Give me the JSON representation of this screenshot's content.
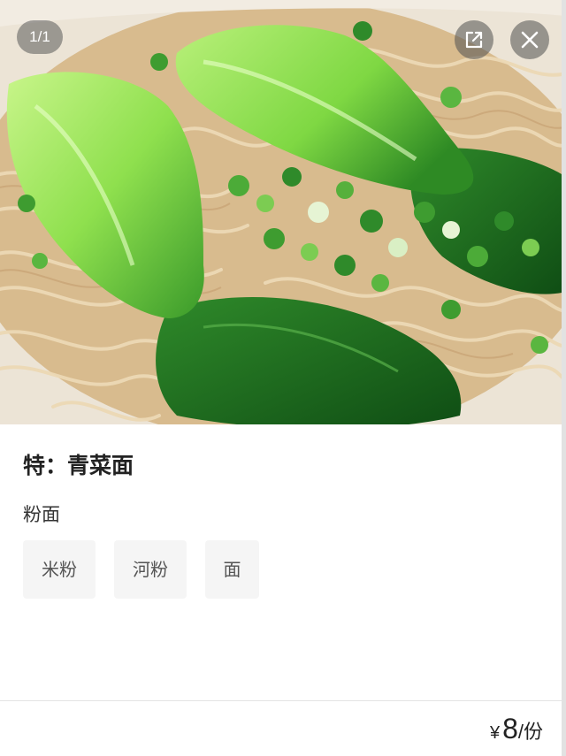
{
  "image": {
    "page_indicator": "1/1",
    "alt_icons": {
      "share": "open-external-icon",
      "close": "close-icon"
    }
  },
  "dish": {
    "name": "特：青菜面",
    "group_label": "粉面",
    "options": [
      "米粉",
      "河粉",
      "面"
    ]
  },
  "price": {
    "currency": "¥",
    "amount": "8",
    "unit": "/份"
  },
  "colors": {
    "bok_choy_light": "#a8ec6a",
    "bok_choy_dark": "#1f6a1f",
    "noodle": "#e3c8a0",
    "broth": "#d9b98c",
    "chip_background": "#f5f5f5"
  }
}
